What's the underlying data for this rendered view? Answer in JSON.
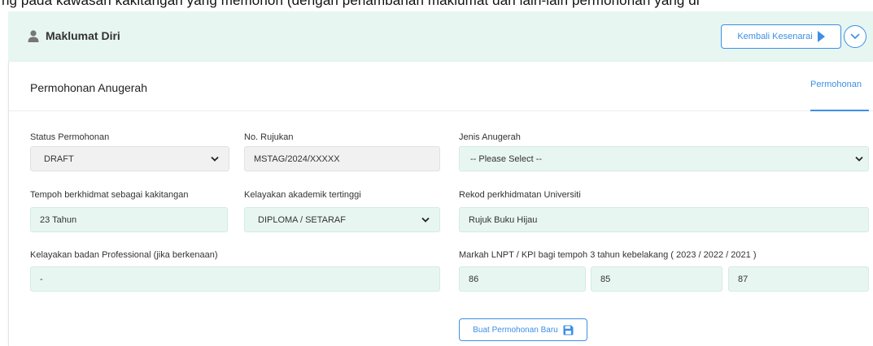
{
  "top_strip_text": "ng pada kawasan kakitangan yang memohon (dengan penambahan maklumat dan lain-lain permohonan yang di",
  "header": {
    "title": "Maklumat Diri",
    "back_label": "Kembali Kesenarai"
  },
  "card": {
    "title": "Permohonan Anugerah",
    "tab_label": "Permohonan"
  },
  "form": {
    "status": {
      "label": "Status Permohonan",
      "value": "DRAFT"
    },
    "rujukan": {
      "label": "No. Rujukan",
      "value": "MSTAG/2024/XXXXX"
    },
    "jenis": {
      "label": "Jenis Anugerah",
      "value": "-- Please Select --"
    },
    "tempoh": {
      "label": "Tempoh berkhidmat sebagai kakitangan",
      "value": "23 Tahun"
    },
    "akademik": {
      "label": "Kelayakan akademik tertinggi",
      "value": "DIPLOMA / SETARAF"
    },
    "rekod": {
      "label": "Rekod perkhidmatan Universiti",
      "value": "Rujuk Buku Hijau"
    },
    "professional": {
      "label": "Kelayakan badan Professional (jika berkenaan)",
      "value": "-"
    },
    "markah": {
      "label": "Markah LNPT / KPI bagi tempoh 3 tahun kebelakang ( 2023 / 2022 / 2021 )",
      "values": [
        "86",
        "85",
        "87"
      ]
    }
  },
  "submit_label": "Buat Permohonan Baru",
  "colors": {
    "accent": "#3d8fe6",
    "header_bg": "#e7f6f1",
    "field_bg": "#e8f6f1"
  },
  "icons": {
    "header": "user-icon",
    "back": "play-icon",
    "collapse": "chevron-down-circle-icon",
    "submit": "floppy-disk-icon"
  }
}
